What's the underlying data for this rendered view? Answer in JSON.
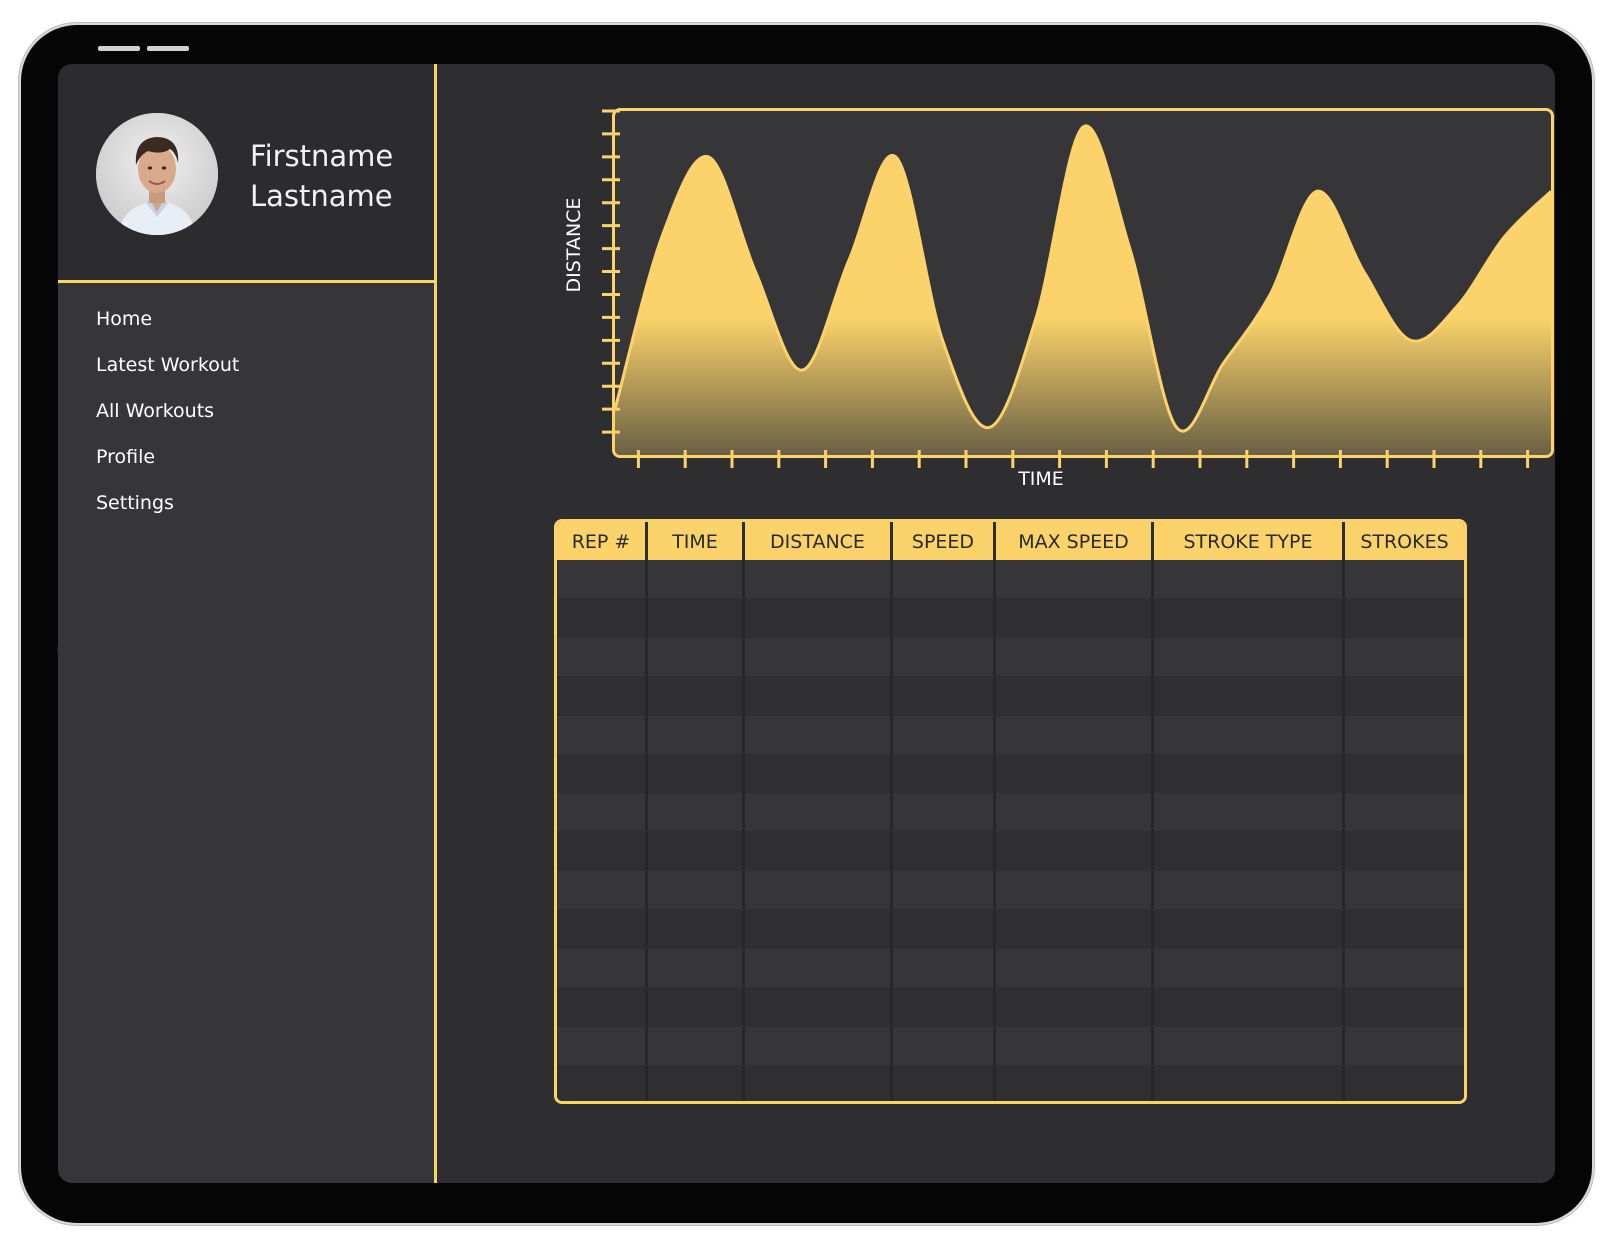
{
  "user": {
    "first_name": "Firstname",
    "last_name": "Lastname"
  },
  "nav": {
    "items": [
      {
        "label": "Home"
      },
      {
        "label": "Latest Workout"
      },
      {
        "label": "All Workouts"
      },
      {
        "label": "Profile"
      },
      {
        "label": "Settings"
      }
    ]
  },
  "colors": {
    "accent": "#fcd36b",
    "screen_bg": "#2e2e30",
    "sidebar_bg": "#363638",
    "profile_bg": "#2c2c2e",
    "row_light": "#363638",
    "row_dark": "#2f2f31"
  },
  "chart_data": {
    "type": "area",
    "xlabel": "TIME",
    "ylabel": "DISTANCE",
    "x": [
      0,
      1,
      2,
      3,
      4,
      5,
      6,
      7,
      8,
      9,
      10,
      11,
      12,
      13,
      14,
      15,
      16,
      17,
      18,
      19,
      20
    ],
    "values": [
      2,
      9.5,
      13,
      8,
      3.7,
      8.5,
      13,
      5,
      1.2,
      6,
      14.3,
      9,
      1.2,
      4,
      7,
      11.5,
      8,
      5,
      6.5,
      9.5,
      11.5
    ],
    "ylim": [
      0,
      15
    ],
    "grid": false,
    "legend": "none"
  },
  "table": {
    "headers": [
      "REP #",
      "TIME",
      "DISTANCE",
      "SPEED",
      "MAX SPEED",
      "STROKE TYPE",
      "STROKES"
    ],
    "row_count": 14
  }
}
